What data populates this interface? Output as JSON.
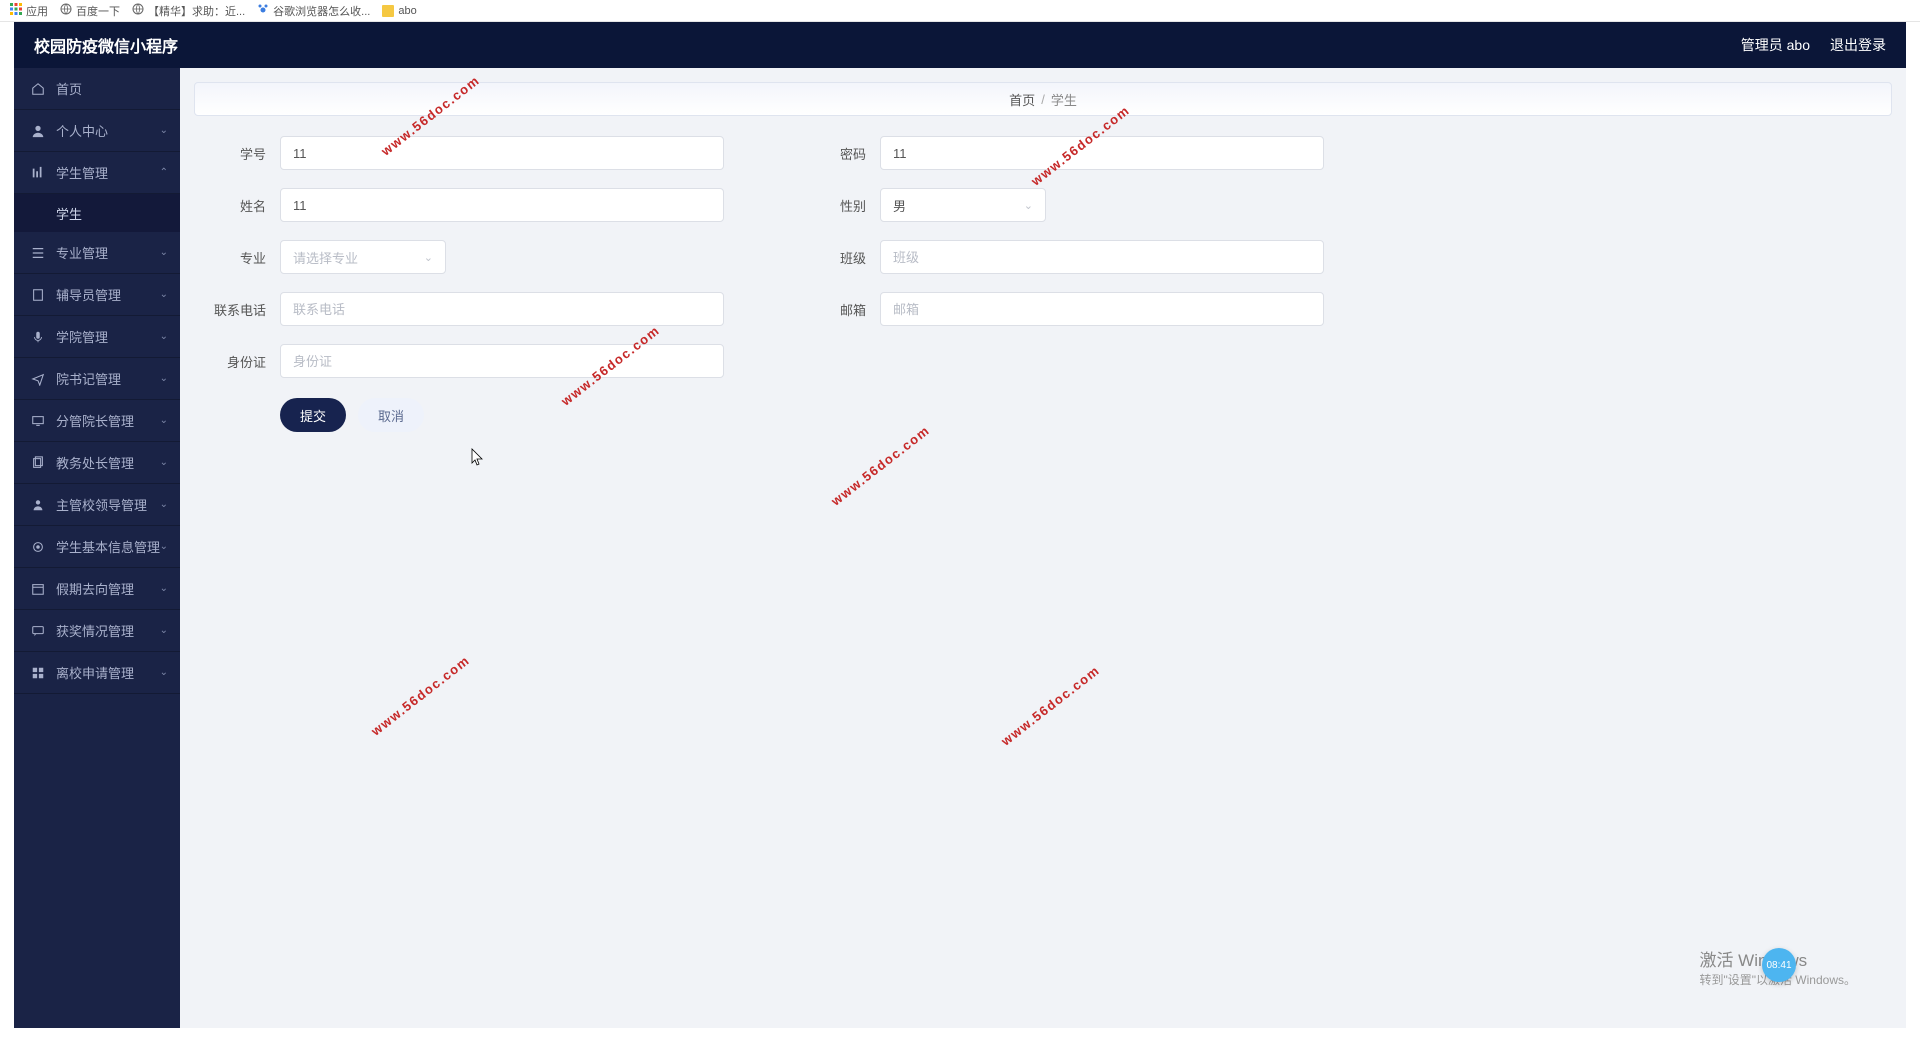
{
  "browser": {
    "apps": "应用",
    "bookmarks": [
      {
        "label": "百度一下",
        "icon": "globe"
      },
      {
        "label": "【精华】求助：近...",
        "icon": "globe"
      },
      {
        "label": "谷歌浏览器怎么收...",
        "icon": "paw"
      },
      {
        "label": "abo",
        "icon": "folder"
      }
    ]
  },
  "header": {
    "title": "校园防疫微信小程序",
    "user": "管理员 abo",
    "logout": "退出登录"
  },
  "sidebar": {
    "items": [
      {
        "label": "首页",
        "icon": "home",
        "expandable": false
      },
      {
        "label": "个人中心",
        "icon": "user",
        "expandable": true
      },
      {
        "label": "学生管理",
        "icon": "bars",
        "expandable": true,
        "expanded": true,
        "children": [
          {
            "label": "学生"
          }
        ]
      },
      {
        "label": "专业管理",
        "icon": "list",
        "expandable": true
      },
      {
        "label": "辅导员管理",
        "icon": "note",
        "expandable": true
      },
      {
        "label": "学院管理",
        "icon": "mic",
        "expandable": true
      },
      {
        "label": "院书记管理",
        "icon": "send",
        "expandable": true
      },
      {
        "label": "分管院长管理",
        "icon": "monitor",
        "expandable": true
      },
      {
        "label": "教务处长管理",
        "icon": "copy",
        "expandable": true
      },
      {
        "label": "主管校领导管理",
        "icon": "person",
        "expandable": true
      },
      {
        "label": "学生基本信息管理",
        "icon": "target",
        "expandable": true
      },
      {
        "label": "假期去向管理",
        "icon": "calendar",
        "expandable": true
      },
      {
        "label": "获奖情况管理",
        "icon": "chat",
        "expandable": true
      },
      {
        "label": "离校申请管理",
        "icon": "grid",
        "expandable": true
      }
    ]
  },
  "breadcrumb": {
    "home": "首页",
    "current": "学生"
  },
  "form": {
    "student_id": {
      "label": "学号",
      "value": "11"
    },
    "password": {
      "label": "密码",
      "value": "11"
    },
    "name": {
      "label": "姓名",
      "value": "11"
    },
    "gender": {
      "label": "性别",
      "value": "男"
    },
    "major": {
      "label": "专业",
      "placeholder": "请选择专业"
    },
    "class": {
      "label": "班级",
      "placeholder": "班级"
    },
    "phone": {
      "label": "联系电话",
      "placeholder": "联系电话"
    },
    "email": {
      "label": "邮箱",
      "placeholder": "邮箱"
    },
    "idcard": {
      "label": "身份证",
      "placeholder": "身份证"
    },
    "submit": "提交",
    "cancel": "取消"
  },
  "watermark": "www.56doc.com",
  "activate": {
    "line1": "激活 Windows",
    "line2": "转到\"设置\"以激活 Windows。"
  },
  "time_badge": "08:41"
}
